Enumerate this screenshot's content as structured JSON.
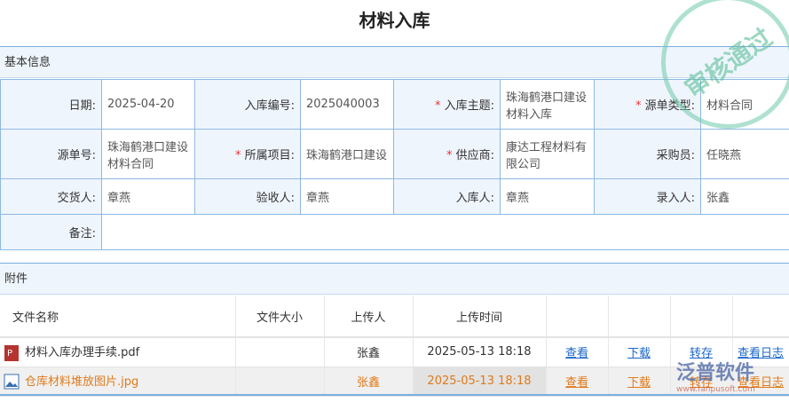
{
  "title": "材料入库",
  "basic_section": "基本信息",
  "fields": {
    "date_label": "日期:",
    "date": "2025-04-20",
    "no_label": "入库编号:",
    "no": "2025040003",
    "subject_label": "入库主题:",
    "subject": "珠海鹤港口建设材料入库",
    "src_type_label": "源单类型:",
    "src_type": "材料合同",
    "src_no_label": "源单号:",
    "src_no": "珠海鹤港口建设材料合同",
    "project_label": "所属项目:",
    "project": "珠海鹤港口建设",
    "supplier_label": "供应商:",
    "supplier": "康达工程材料有限公司",
    "buyer_label": "采购员:",
    "buyer": "任晓燕",
    "deliverer_label": "交货人:",
    "deliverer": "章燕",
    "inspector_label": "验收人:",
    "inspector": "章燕",
    "receiver_label": "入库人:",
    "receiver": "章燕",
    "entry_label": "录入人:",
    "entry": "张鑫",
    "remark_label": "备注:",
    "remark": ""
  },
  "required_mark": "*",
  "attach_section": "附件",
  "attach_headers": [
    "文件名称",
    "文件大小",
    "上传人",
    "上传时间"
  ],
  "attachments": [
    {
      "name": "材料入库办理手续.pdf",
      "size": "",
      "uploader": "张鑫",
      "time": "2025-05-13 18:18",
      "icon": "pdf-icon"
    },
    {
      "name": "仓库材料堆放图片.jpg",
      "size": "",
      "uploader": "张鑫",
      "time": "2025-05-13 18:18",
      "icon": "image-icon"
    }
  ],
  "actions": {
    "view": "查看",
    "download": "下载",
    "transfer": "转存",
    "log": "查看日志"
  },
  "stamp": "审核通过",
  "watermark": {
    "brand": "泛普软件",
    "url": "www.fanpusoft.com"
  }
}
